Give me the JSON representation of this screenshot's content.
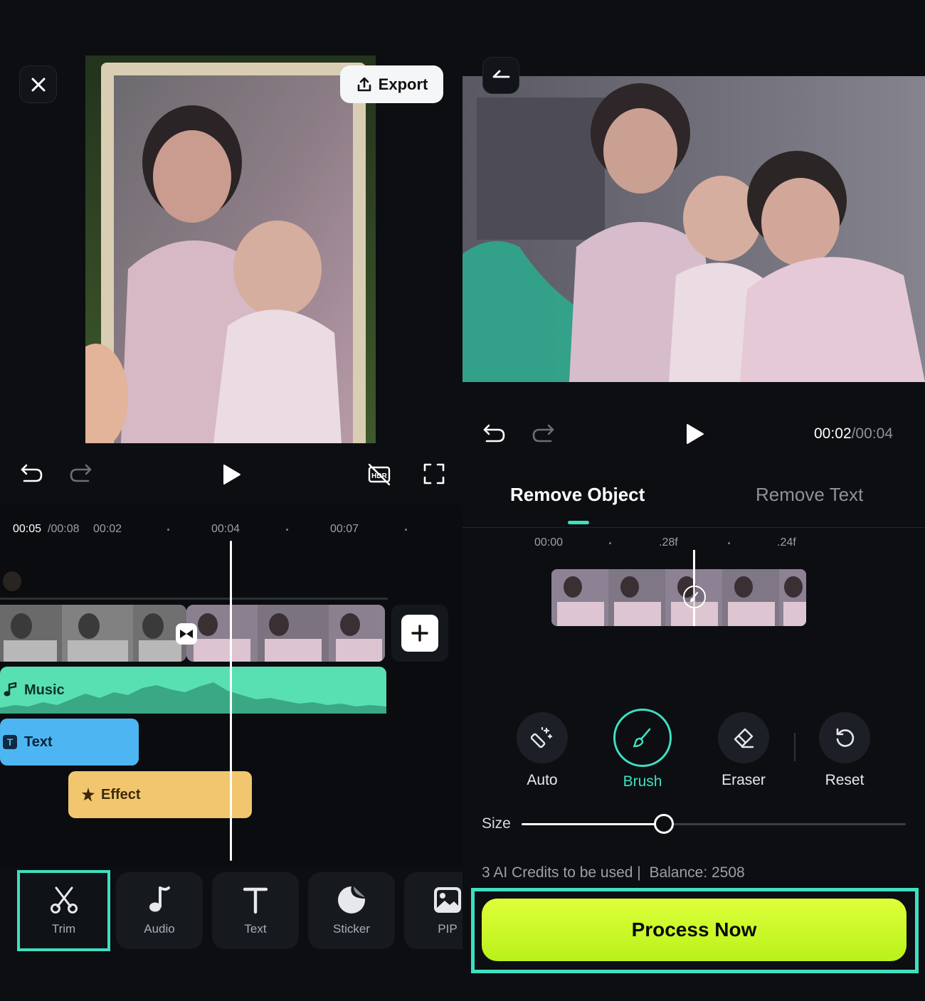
{
  "left_editor": {
    "export_label": "Export",
    "timeline": {
      "current_time": "00:05",
      "total_time": "/00:08",
      "ticks": [
        "00:02",
        "00:04",
        "00:07"
      ]
    },
    "tracks": {
      "music_label": "Music",
      "text_label": "Text",
      "effect_label": "Effect"
    },
    "toolbar": [
      {
        "label": "Trim",
        "icon": "scissors-icon",
        "active": true
      },
      {
        "label": "Audio",
        "icon": "music-note-icon",
        "active": false
      },
      {
        "label": "Text",
        "icon": "text-icon",
        "active": false
      },
      {
        "label": "Sticker",
        "icon": "sticker-icon",
        "active": false
      },
      {
        "label": "PIP",
        "icon": "image-icon",
        "active": false
      }
    ]
  },
  "right_editor": {
    "time_current": "00:02",
    "time_total": "/00:04",
    "tabs": [
      {
        "label": "Remove Object",
        "active": true
      },
      {
        "label": "Remove Text",
        "active": false
      }
    ],
    "ruler_ticks": [
      "00:00",
      ".28f",
      ".24f"
    ],
    "tools": [
      {
        "label": "Auto",
        "icon": "magic-wand-icon"
      },
      {
        "label": "Brush",
        "icon": "brush-icon",
        "active": true
      },
      {
        "label": "Eraser",
        "icon": "eraser-icon"
      },
      {
        "label": "Reset",
        "icon": "reset-icon"
      }
    ],
    "size_label": "Size",
    "size_level": 0.37,
    "credits_text": "3 AI Credits to be used |",
    "balance_text": "Balance: 2508",
    "process_label": "Process Now"
  },
  "colors": {
    "accent": "#3ee0c0",
    "music_track": "#58e0b3",
    "text_track": "#4db6f2",
    "effect_track": "#f2c66e",
    "process_button": "#c8f52a"
  }
}
